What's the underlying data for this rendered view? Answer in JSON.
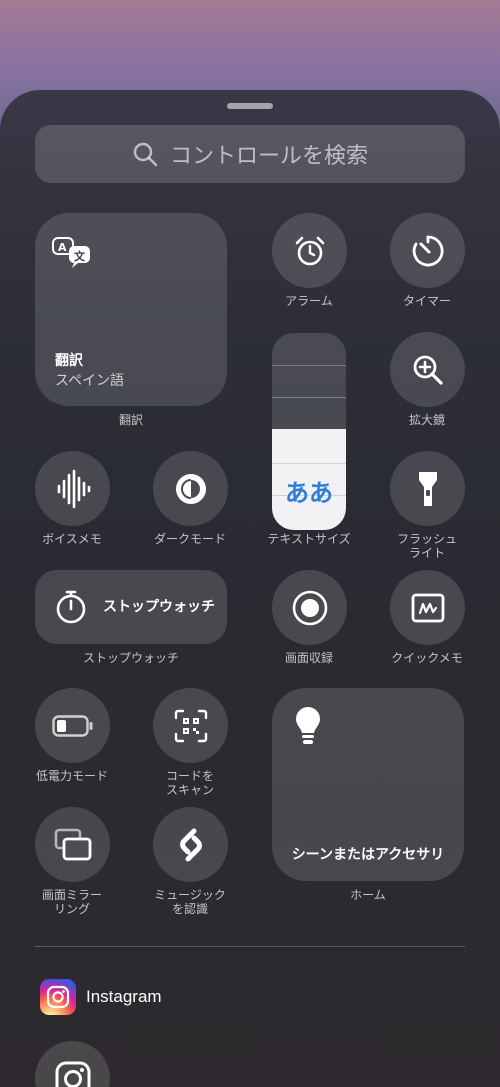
{
  "search": {
    "placeholder": "コントロールを検索"
  },
  "controls": {
    "translate": {
      "title": "翻訳",
      "subtitle": "スペイン語",
      "label": "翻訳"
    },
    "alarm": {
      "label": "アラーム"
    },
    "timer": {
      "label": "タイマー"
    },
    "magnifier": {
      "label": "拡大鏡"
    },
    "text_size": {
      "label": "テキストサイズ",
      "sample": "ああ"
    },
    "voice_memo": {
      "label": "ボイスメモ"
    },
    "dark_mode": {
      "label": "ダークモード"
    },
    "flashlight": {
      "label": "フラッシュ\nライト"
    },
    "stopwatch": {
      "title": "ストップウォッチ",
      "label": "ストップウォッチ"
    },
    "screen_record": {
      "label": "画面収録"
    },
    "quick_note": {
      "label": "クイックメモ"
    },
    "low_power": {
      "label": "低電力モード"
    },
    "code_scanner": {
      "label": "コードを\nスキャン"
    },
    "home": {
      "title": "シーンまたはアクセサリ",
      "label": "ホーム"
    },
    "screen_mirroring": {
      "label": "画面ミラー\nリング"
    },
    "shazam": {
      "label": "ミュージック\nを認識"
    }
  },
  "apps": {
    "section_title": "Instagram"
  },
  "icons": [
    "search-icon",
    "translate-icon",
    "alarm-icon",
    "timer-icon",
    "magnifier-icon",
    "waveform-icon",
    "dark-mode-icon",
    "flashlight-icon",
    "stopwatch-icon",
    "record-icon",
    "quick-note-icon",
    "battery-icon",
    "qr-code-icon",
    "lightbulb-icon",
    "screen-mirroring-icon",
    "shazam-icon",
    "instagram-icon"
  ],
  "colors": {
    "accent": "#2f7ddb",
    "instagram": "#d6249f"
  }
}
